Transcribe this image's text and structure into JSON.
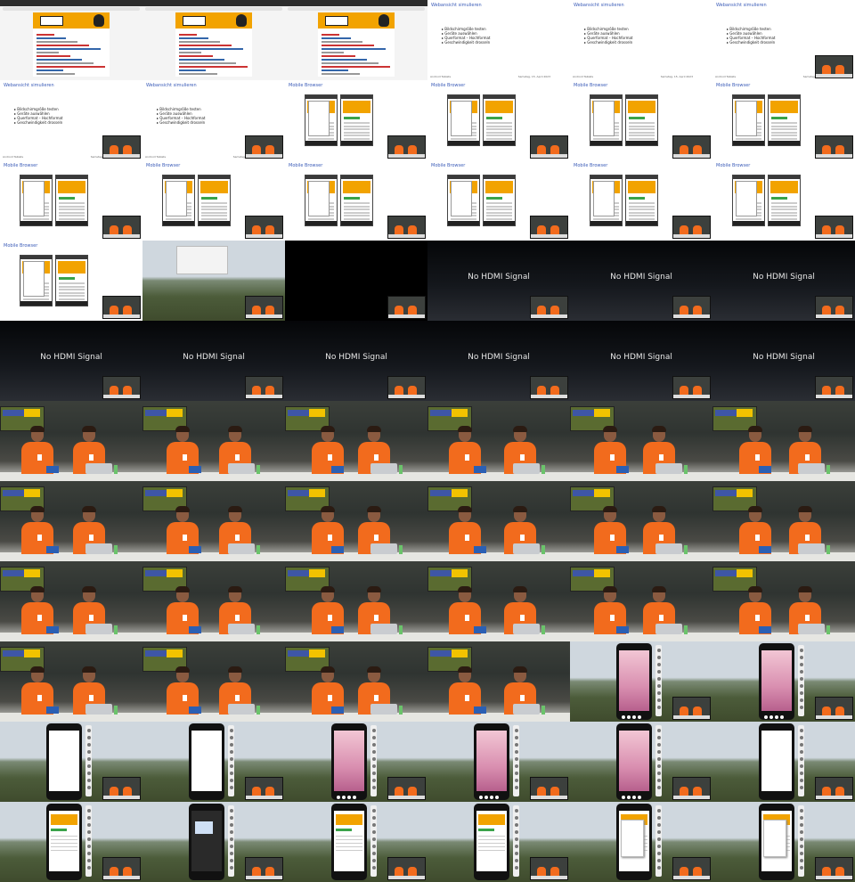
{
  "contact_sheet": {
    "columns": 6,
    "rows": 11
  },
  "slide_web": {
    "title": "Webansicht simulieren",
    "bullets": [
      "Bildschirmgröße testen",
      "Geräte auswählen",
      "Querformat – Hochformat",
      "Geschwindigkeit drosseln"
    ],
    "footer_left": "Android Tablets",
    "footer_right": "Samstag, 15. April 2023"
  },
  "slide_mobile": {
    "title": "Mobile Browser"
  },
  "no_signal": {
    "text": "No HDMI Signal"
  },
  "cells": [
    "browser",
    "browser",
    "browser",
    "slide_web",
    "slide_web",
    "slide_web_pip",
    "slide_web_pip",
    "slide_web_pip",
    "slide_mobile",
    "slide_mobile",
    "slide_mobile",
    "slide_mobile",
    "slide_mobile",
    "slide_mobile",
    "slide_mobile",
    "slide_mobile",
    "slide_mobile",
    "slide_mobile",
    "slide_mobile",
    "landscape_dialog",
    "black_pip",
    "nosignal",
    "nosignal",
    "nosignal",
    "nosignal",
    "nosignal",
    "nosignal",
    "nosignal",
    "nosignal",
    "nosignal",
    "stage",
    "stage",
    "stage",
    "stage",
    "stage",
    "stage",
    "stage",
    "stage",
    "stage",
    "stage",
    "stage",
    "stage",
    "stage",
    "stage",
    "stage",
    "stage",
    "stage",
    "stage",
    "stage",
    "stage",
    "stage",
    "stage",
    "emu_pink",
    "emu_pink",
    "emu_white",
    "emu_white",
    "emu_pink",
    "emu_pink",
    "emu_pink",
    "emu_white",
    "emu_site",
    "emu_dark",
    "emu_site",
    "emu_site",
    "emu_menu",
    "emu_menu"
  ]
}
